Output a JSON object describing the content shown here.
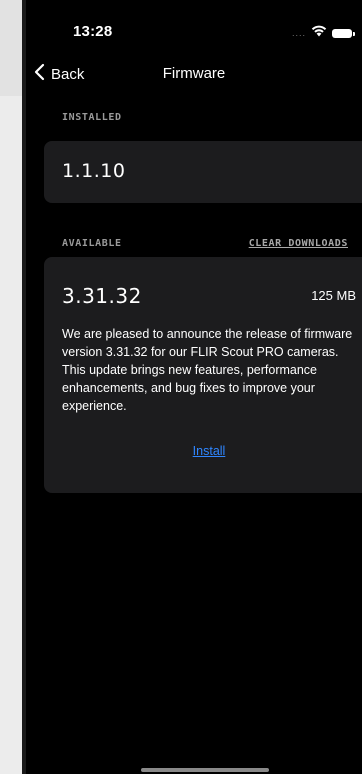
{
  "status_bar": {
    "time": "13:28",
    "signal_dots": "....",
    "icons": [
      "wifi-icon",
      "battery-icon"
    ]
  },
  "nav": {
    "back_label": "Back",
    "title": "Firmware"
  },
  "installed": {
    "section_label": "INSTALLED",
    "version": "1.1.10"
  },
  "available": {
    "section_label": "AVAILABLE",
    "clear_label": "CLEAR DOWNLOADS",
    "version": "3.31.32",
    "size": "125 MB",
    "description": "We are pleased to announce the release of firmware version 3.31.32 for our FLIR Scout PRO cameras. This update brings new features, performance enhancements, and bug fixes to improve your experience.",
    "install_label": "Install"
  },
  "colors": {
    "background": "#000000",
    "card": "#1c1c1e",
    "label_gray": "#9a9a9a",
    "link_blue": "#2f86ff"
  }
}
